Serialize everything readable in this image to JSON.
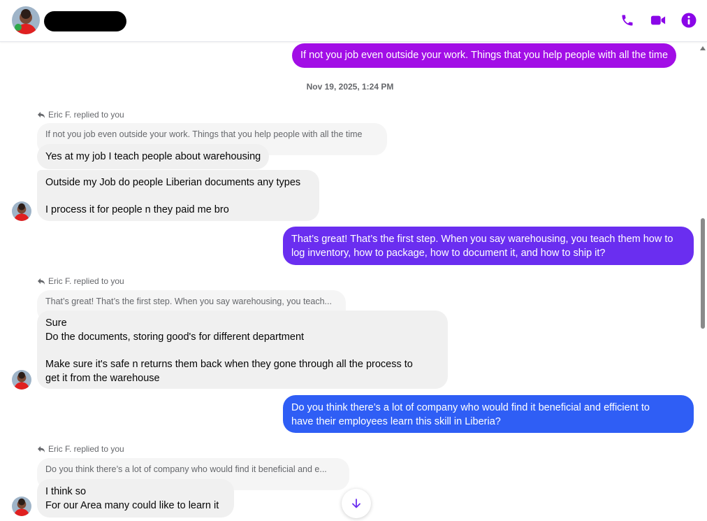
{
  "header": {
    "call_icon": "phone-icon",
    "video_icon": "video-icon",
    "info_icon": "info-icon",
    "accent_color": "#8a06e8"
  },
  "thread": {
    "messages": [
      {
        "sender": "me",
        "text_lines": [
          "If not you job even outside your work. Things that you help people with all the time"
        ]
      },
      {
        "type": "timestamp",
        "text": "Nov 19, 2025, 1:24 PM"
      },
      {
        "sender": "Eric F.",
        "replied_label": "Eric F. replied to you",
        "quoted": "If not you job even outside your work. Things that you help people with all the time",
        "text_lines": [
          "Yes at my job I teach people about warehousing"
        ]
      },
      {
        "sender": "Eric F.",
        "text_lines": [
          "Outside my Job do people Liberian documents any types",
          "",
          "I process it for people n they paid me bro"
        ]
      },
      {
        "sender": "me",
        "text_lines": [
          "That’s great! That’s the first step. When you say warehousing, you teach them how to",
          "log inventory, how to package, how to document it, and how to ship it?"
        ]
      },
      {
        "sender": "Eric F.",
        "replied_label": "Eric F. replied to you",
        "quoted": "That’s great! That’s the first step. When you say warehousing, you teach...",
        "text_lines": [
          "Sure",
          "Do the documents, storing good's for different department",
          "",
          "Make sure it's safe n returns them back when they gone through all the process to",
          "get it from the warehouse"
        ]
      },
      {
        "sender": "me",
        "text_lines": [
          "Do you think there’s a lot of company who would find it beneficial and efficient to",
          "have their employees learn this skill in Liberia?"
        ]
      },
      {
        "sender": "Eric F.",
        "replied_label": "Eric F. replied to you",
        "quoted": "Do you think there’s a lot of company who would find it beneficial and e...",
        "text_lines": [
          "I think so",
          "For our Area many could like to learn it"
        ]
      }
    ]
  },
  "colors": {
    "outgoing_top": "#a20ee6",
    "outgoing_mid": "#6a2ef0",
    "outgoing_bottom": "#2f5ef5",
    "incoming_bg": "#f0f0f0"
  },
  "scroll_down_icon": "arrow-down-icon"
}
